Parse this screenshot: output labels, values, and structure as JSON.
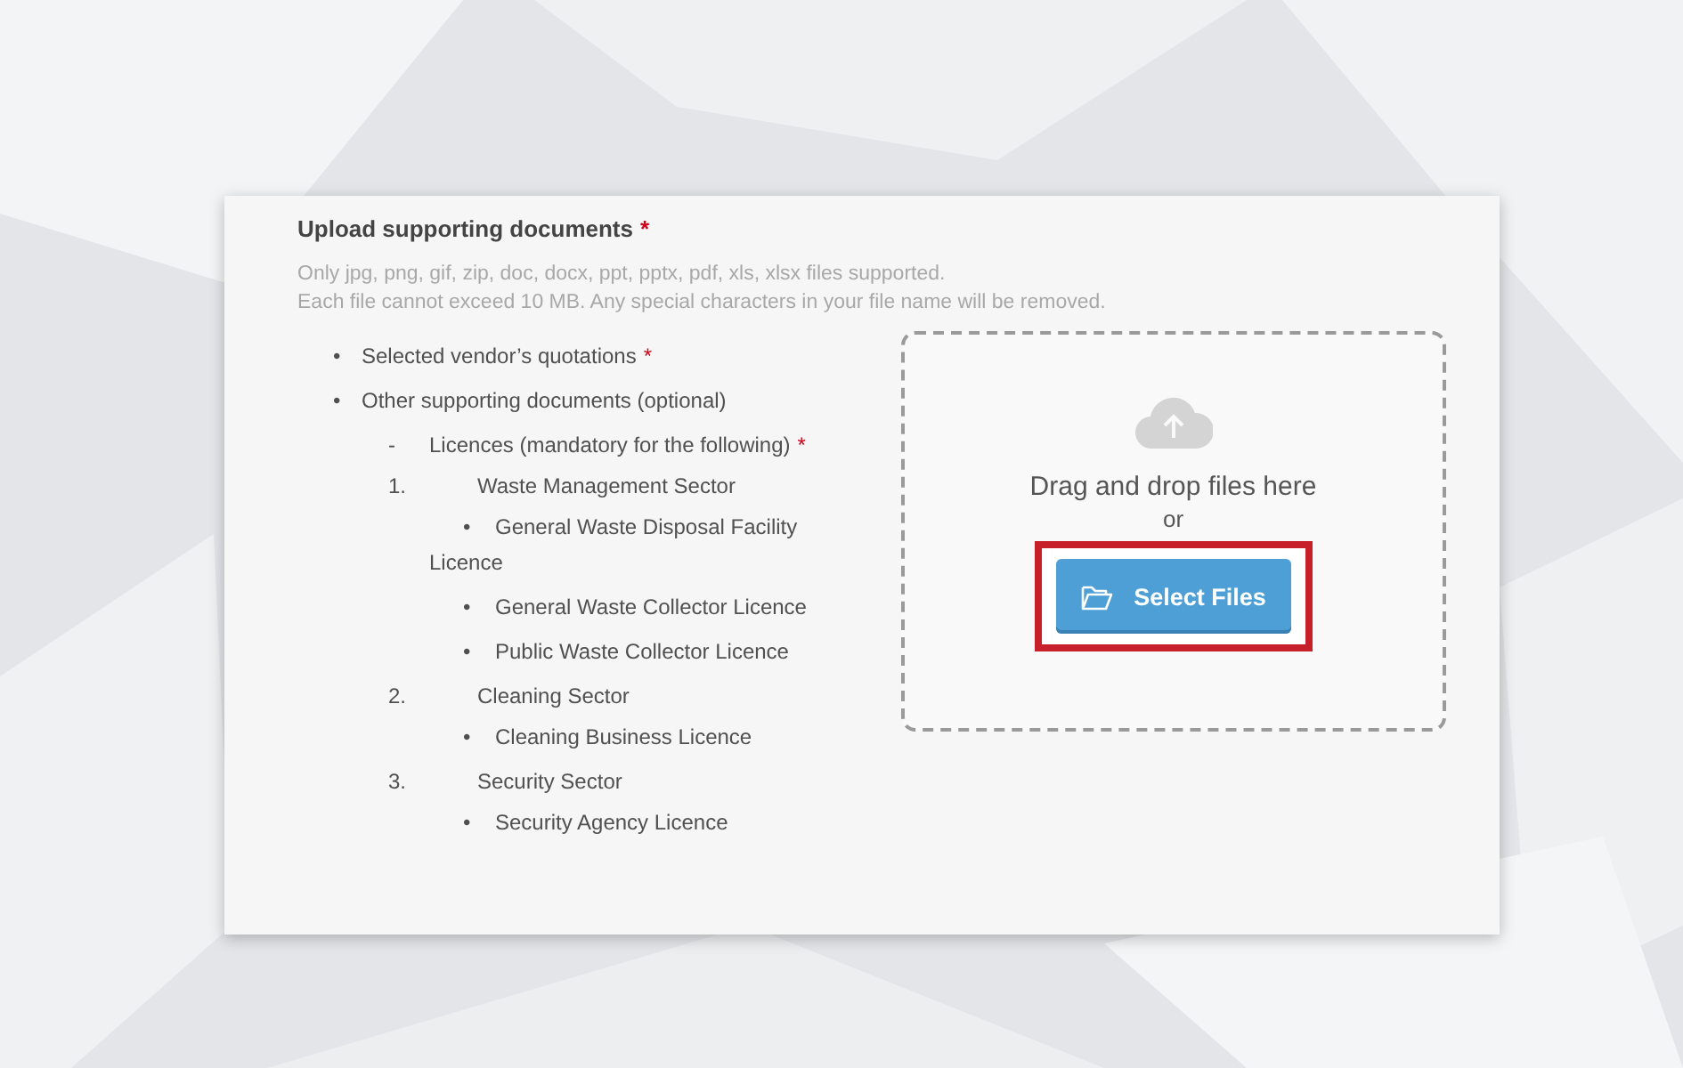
{
  "section": {
    "title": "Upload supporting documents",
    "required_mark": "*",
    "hint_lines": [
      "Only jpg, png, gif, zip, doc, docx, ppt, pptx, pdf, xls, xlsx files supported.",
      "Each file cannot exceed 10 MB. Any special characters in your file name will be removed."
    ]
  },
  "requirements": [
    {
      "kind": "bullet",
      "marker": "•",
      "text": "Selected vendor’s quotations",
      "required_mark": "*"
    },
    {
      "kind": "bullet",
      "marker": "•",
      "text": "Other supporting documents (optional)",
      "children": [
        {
          "kind": "dash",
          "marker": "-",
          "text": "Licences (mandatory for the following)",
          "required_mark": "*",
          "children": [
            {
              "kind": "numbered",
              "marker": "1.",
              "text": "Waste Management Sector",
              "children": [
                {
                  "kind": "sub_bullet",
                  "marker": "•",
                  "text": "General Waste Disposal Facility Licence"
                },
                {
                  "kind": "sub_bullet",
                  "marker": "•",
                  "text": "General Waste Collector Licence"
                },
                {
                  "kind": "sub_bullet",
                  "marker": "•",
                  "text": "Public Waste Collector Licence"
                }
              ]
            },
            {
              "kind": "numbered",
              "marker": "2.",
              "text": "Cleaning Sector",
              "children": [
                {
                  "kind": "sub_bullet",
                  "marker": "•",
                  "text": "Cleaning Business Licence"
                }
              ]
            },
            {
              "kind": "numbered",
              "marker": "3.",
              "text": "Security Sector",
              "children": [
                {
                  "kind": "sub_bullet",
                  "marker": "•",
                  "text": "Security Agency Licence"
                }
              ]
            }
          ]
        }
      ]
    }
  ],
  "dropzone": {
    "prompt": "Drag and drop files here",
    "separator": "or",
    "button": {
      "label": "Select Files",
      "highlighted": true
    }
  }
}
